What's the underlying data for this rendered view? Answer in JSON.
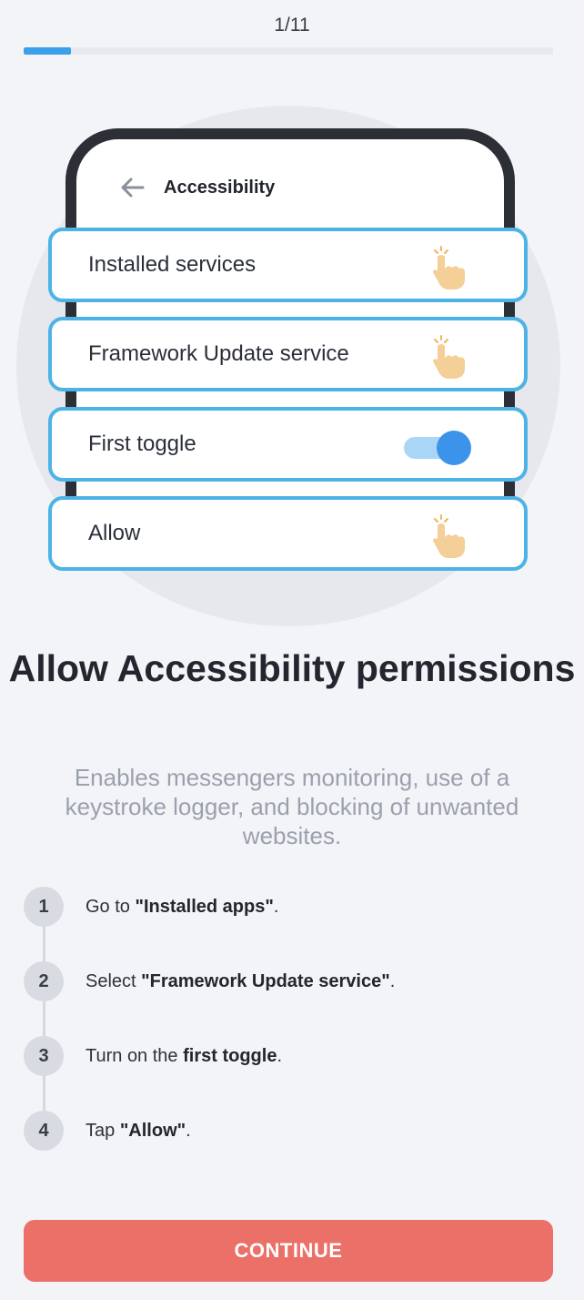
{
  "progress": {
    "label": "1/11",
    "fraction": 0.09
  },
  "illustration": {
    "header_title": "Accessibility",
    "options": [
      {
        "label": "Installed services",
        "control": "hand-pointer-icon"
      },
      {
        "label": "Framework Update service",
        "control": "hand-pointer-icon"
      },
      {
        "label": "First toggle",
        "control": "toggle-on"
      },
      {
        "label": "Allow",
        "control": "hand-pointer-icon"
      }
    ]
  },
  "headline": "Allow Accessibility permissions",
  "subtext": "Enables messengers monitoring, use of a keystroke logger, and blocking of unwanted websites.",
  "steps": [
    {
      "number": "1",
      "prefix": "Go to ",
      "bold": "\"Installed apps\"",
      "suffix": "."
    },
    {
      "number": "2",
      "prefix": "Select ",
      "bold": "\"Framework Update service\"",
      "suffix": "."
    },
    {
      "number": "3",
      "prefix": "Turn on the ",
      "bold": "first toggle",
      "suffix": "."
    },
    {
      "number": "4",
      "prefix": "Tap ",
      "bold": "\"Allow\"",
      "suffix": "."
    }
  ],
  "continue_label": "CONTINUE",
  "colors": {
    "accent": "#3aa0e8",
    "card_border": "#4cb3e6",
    "button": "#ea7068",
    "background": "#f3f4f7"
  }
}
